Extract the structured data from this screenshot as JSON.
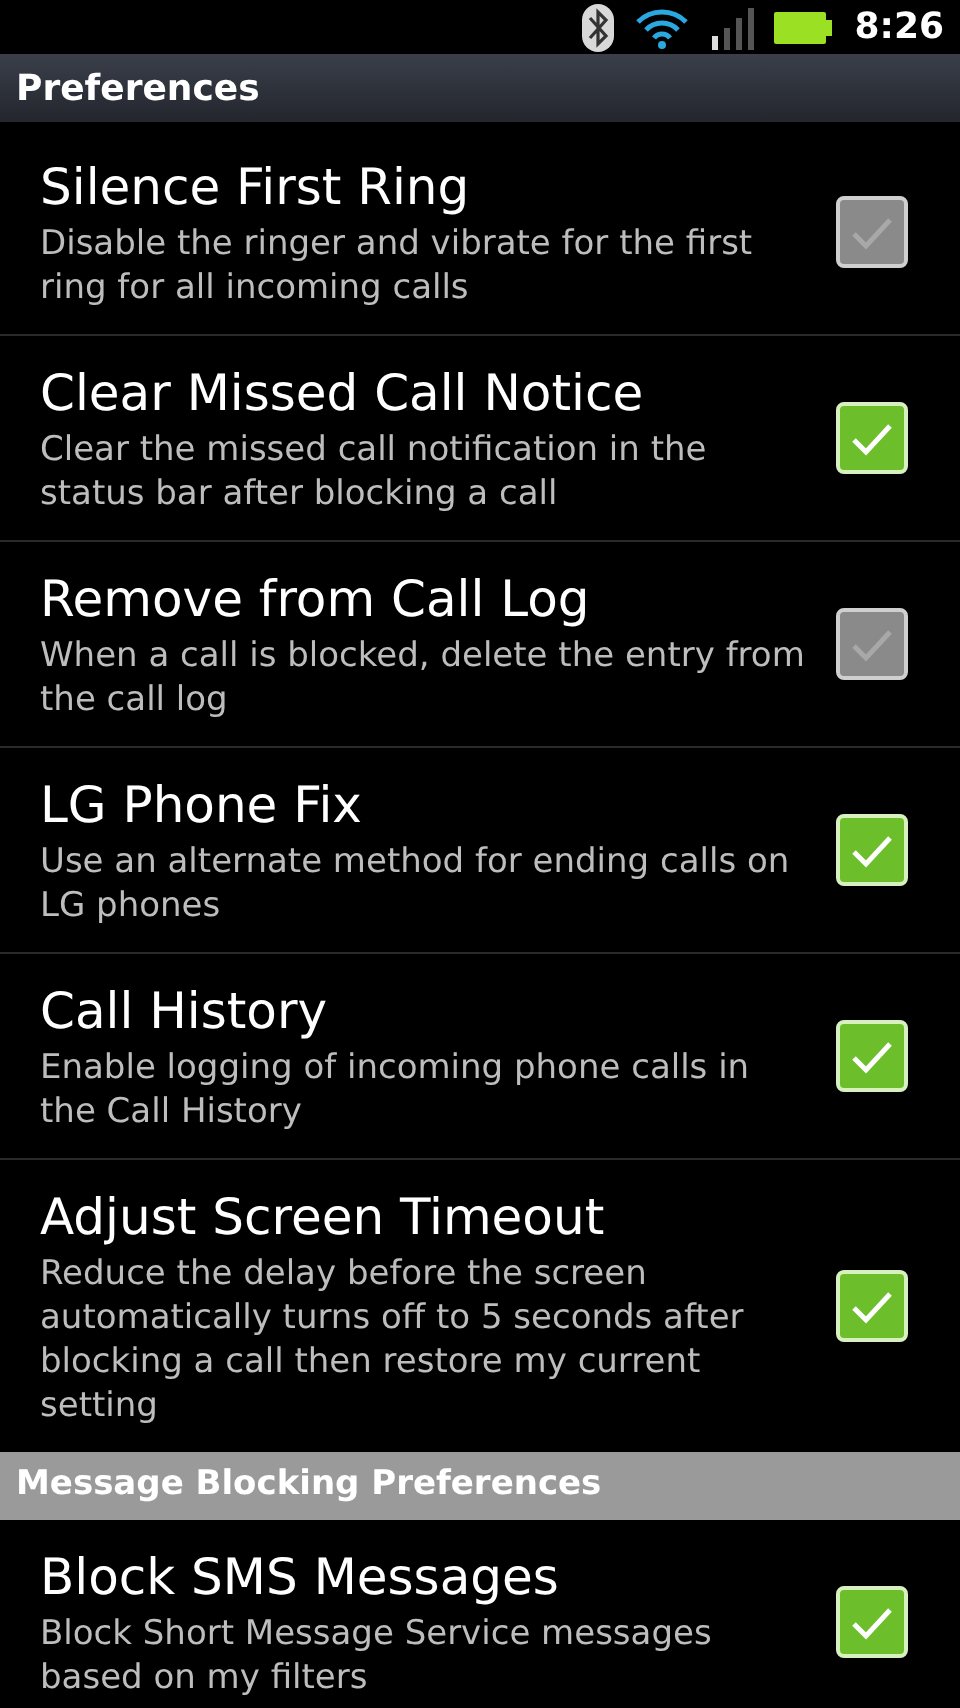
{
  "status_bar": {
    "time": "8:26"
  },
  "sections": [
    {
      "title": "Preferences",
      "items": [
        {
          "title": "Silence First Ring",
          "summary": "Disable the ringer and vibrate for the first ring for all incoming calls",
          "checked": false
        },
        {
          "title": "Clear Missed Call Notice",
          "summary": "Clear the missed call notification in the status bar after blocking a call",
          "checked": true
        },
        {
          "title": "Remove from Call Log",
          "summary": "When a call is blocked, delete the entry from the call log",
          "checked": false
        },
        {
          "title": "LG Phone Fix",
          "summary": "Use an alternate method for ending calls on LG phones",
          "checked": true
        },
        {
          "title": "Call History",
          "summary": "Enable logging of incoming phone calls in the Call History",
          "checked": true
        },
        {
          "title": "Adjust Screen Timeout",
          "summary": "Reduce the delay before the screen automatically turns off to 5 seconds after blocking a call then restore my current setting",
          "checked": true
        }
      ]
    },
    {
      "title": "Message Blocking Preferences",
      "items": [
        {
          "title": "Block SMS Messages",
          "summary": "Block Short Message Service messages based on my filters",
          "checked": true
        }
      ]
    }
  ]
}
